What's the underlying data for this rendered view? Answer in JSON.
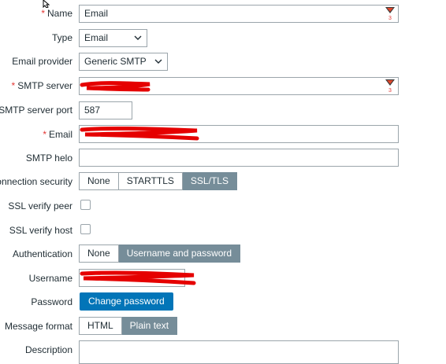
{
  "form": {
    "name": {
      "label": "Name",
      "value": "Email",
      "required": true
    },
    "type": {
      "label": "Type",
      "selected": "Email"
    },
    "email_provider": {
      "label": "Email provider",
      "selected": "Generic SMTP"
    },
    "smtp_server": {
      "label": "SMTP server",
      "required": true,
      "redacted": true
    },
    "smtp_port": {
      "label": "SMTP server port",
      "value": "587"
    },
    "email": {
      "label": "Email",
      "required": true,
      "redacted": true
    },
    "smtp_helo": {
      "label": "SMTP helo",
      "value": ""
    },
    "connection_security": {
      "label": "Connection security",
      "options": [
        "None",
        "STARTTLS",
        "SSL/TLS"
      ],
      "selected": "SSL/TLS"
    },
    "ssl_verify_peer": {
      "label": "SSL verify peer",
      "checked": false
    },
    "ssl_verify_host": {
      "label": "SSL verify host",
      "checked": false
    },
    "authentication": {
      "label": "Authentication",
      "options": [
        "None",
        "Username and password"
      ],
      "selected": "Username and password"
    },
    "username": {
      "label": "Username",
      "redacted": true
    },
    "password": {
      "label": "Password",
      "button": "Change password"
    },
    "message_format": {
      "label": "Message format",
      "options": [
        "HTML",
        "Plain text"
      ],
      "selected": "Plain text"
    },
    "description": {
      "label": "Description",
      "value": ""
    }
  },
  "colors": {
    "required_marker": "#e33734",
    "segment_active": "#768d99",
    "primary_button": "#0275b8",
    "input_border": "#9ba5ab",
    "redaction": "#e50000"
  },
  "icons": {
    "macro": "macro-suggest-icon",
    "dropdown": "chevron-down-icon",
    "cursor": "mouse-cursor-icon"
  }
}
